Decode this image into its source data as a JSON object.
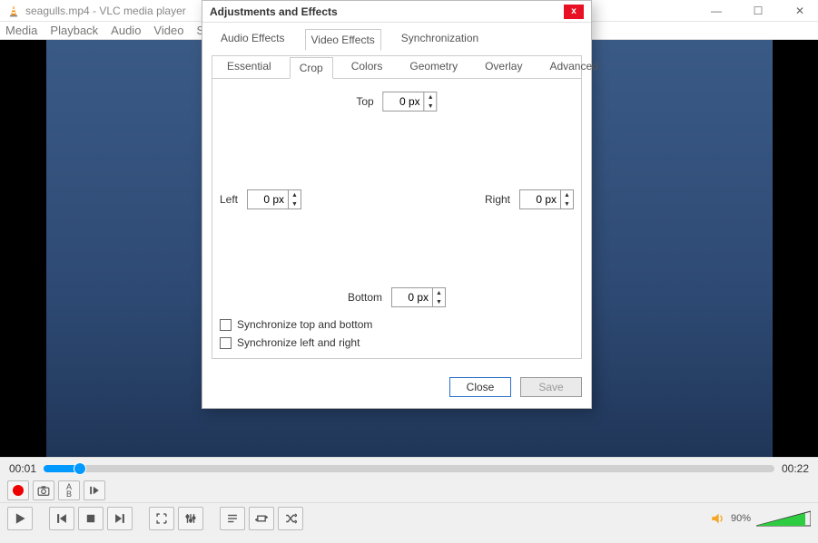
{
  "titleBar": {
    "title": "seagulls.mp4 - VLC media player",
    "minimize": "—",
    "maximize": "☐",
    "close": "✕"
  },
  "menuBar": {
    "items": [
      "Media",
      "Playback",
      "Audio",
      "Video",
      "Su"
    ]
  },
  "seek": {
    "elapsed": "00:01",
    "total": "00:22"
  },
  "volume": {
    "label": "90%",
    "iconName": "volume-icon"
  },
  "dialog": {
    "title": "Adjustments and Effects",
    "close": "x",
    "tabs": [
      "Audio Effects",
      "Video Effects",
      "Synchronization"
    ],
    "activeTab": "Video Effects",
    "subTabs": [
      "Essential",
      "Crop",
      "Colors",
      "Geometry",
      "Overlay",
      "Advanced"
    ],
    "activeSubTab": "Crop",
    "crop": {
      "topLabel": "Top",
      "topValue": "0 px",
      "bottomLabel": "Bottom",
      "bottomValue": "0 px",
      "leftLabel": "Left",
      "leftValue": "0 px",
      "rightLabel": "Right",
      "rightValue": "0 px",
      "syncTB": "Synchronize top and bottom",
      "syncLR": "Synchronize left and right"
    },
    "buttons": {
      "close": "Close",
      "save": "Save"
    }
  }
}
